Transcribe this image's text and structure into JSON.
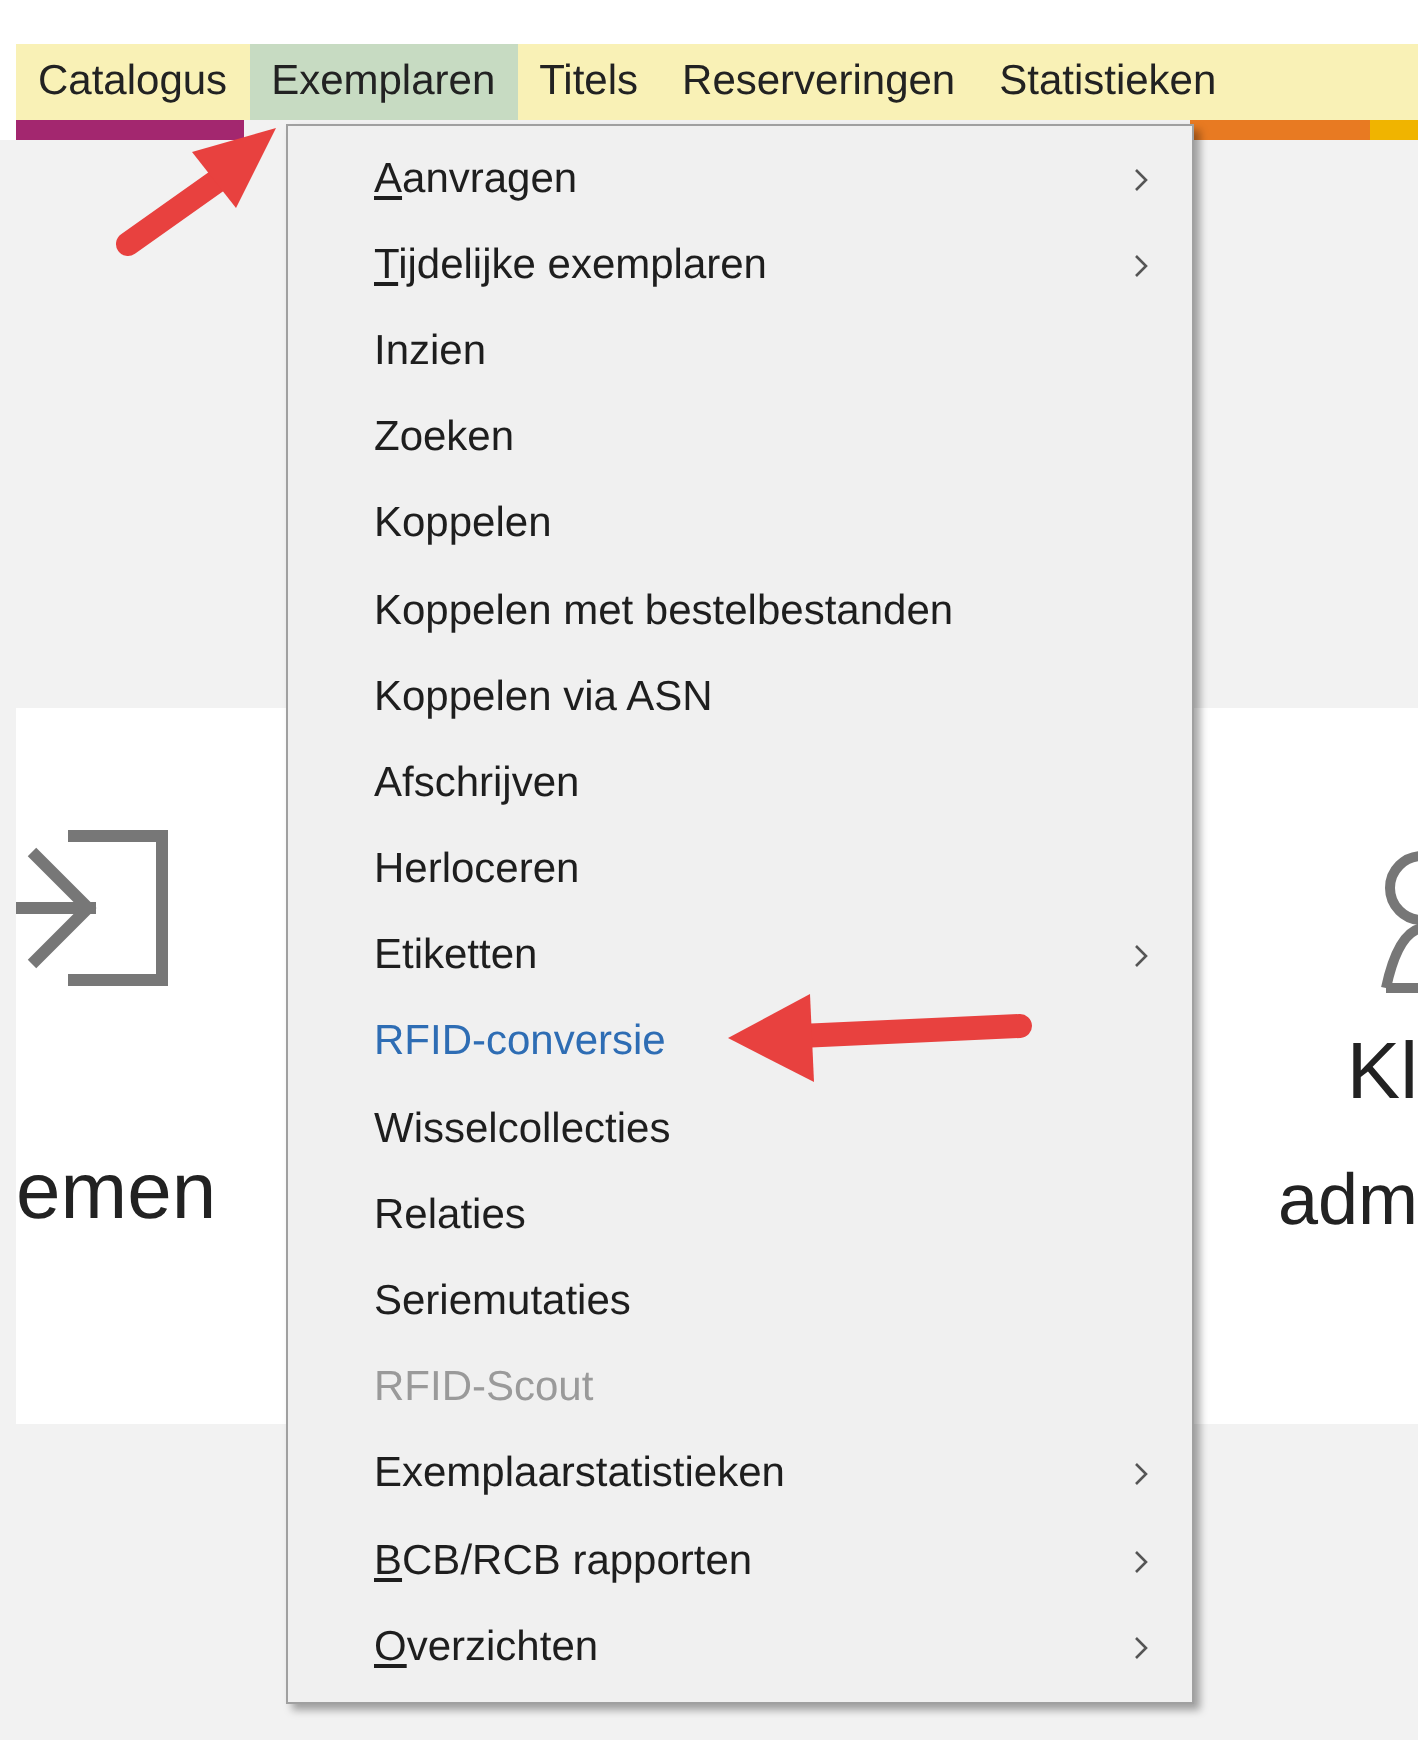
{
  "menubar": [
    {
      "label": "Catalogus",
      "selected": false
    },
    {
      "label": "Exemplaren",
      "selected": true
    },
    {
      "label": "Titels",
      "selected": false
    },
    {
      "label": "Reserveringen",
      "selected": false
    },
    {
      "label": "Statistieken",
      "selected": false
    }
  ],
  "menu": {
    "items": [
      {
        "label": "Aanvragen",
        "access_key": true,
        "submenu": true,
        "selected": false,
        "disabled": false
      },
      {
        "label": "Tijdelijke exemplaren",
        "access_key": true,
        "submenu": true,
        "selected": false,
        "disabled": false
      },
      {
        "label": "Inzien",
        "access_key": false,
        "submenu": false,
        "selected": false,
        "disabled": false
      },
      {
        "label": "Zoeken",
        "access_key": false,
        "submenu": false,
        "selected": false,
        "disabled": false
      },
      {
        "label": "Koppelen",
        "access_key": false,
        "submenu": false,
        "selected": false,
        "disabled": false
      },
      {
        "label": "Koppelen met bestelbestanden",
        "access_key": false,
        "submenu": false,
        "selected": false,
        "disabled": false
      },
      {
        "label": "Koppelen via ASN",
        "access_key": false,
        "submenu": false,
        "selected": false,
        "disabled": false
      },
      {
        "label": "Afschrijven",
        "access_key": false,
        "submenu": false,
        "selected": false,
        "disabled": false
      },
      {
        "label": "Herloceren",
        "access_key": false,
        "submenu": false,
        "selected": false,
        "disabled": false
      },
      {
        "label": "Etiketten",
        "access_key": false,
        "submenu": true,
        "selected": false,
        "disabled": false
      },
      {
        "label": "RFID-conversie",
        "access_key": false,
        "submenu": false,
        "selected": true,
        "disabled": false
      },
      {
        "label": "Wisselcollecties",
        "access_key": false,
        "submenu": false,
        "selected": false,
        "disabled": false
      },
      {
        "label": "Relaties",
        "access_key": false,
        "submenu": false,
        "selected": false,
        "disabled": false
      },
      {
        "label": "Seriemutaties",
        "access_key": false,
        "submenu": false,
        "selected": false,
        "disabled": false
      },
      {
        "label": "RFID-Scout",
        "access_key": false,
        "submenu": false,
        "selected": false,
        "disabled": true
      },
      {
        "label": "Exemplaarstatistieken",
        "access_key": false,
        "submenu": true,
        "selected": false,
        "disabled": false
      },
      {
        "label": "BCB/RCB rapporten",
        "access_key": true,
        "submenu": true,
        "selected": false,
        "disabled": false
      },
      {
        "label": "Overzichten",
        "access_key": true,
        "submenu": true,
        "selected": false,
        "disabled": false
      }
    ]
  },
  "tiles": [
    {
      "kind": "sign-in",
      "lines": [
        "emen"
      ]
    },
    {
      "kind": "person",
      "lines": [
        "Kl",
        "adm"
      ]
    }
  ]
}
